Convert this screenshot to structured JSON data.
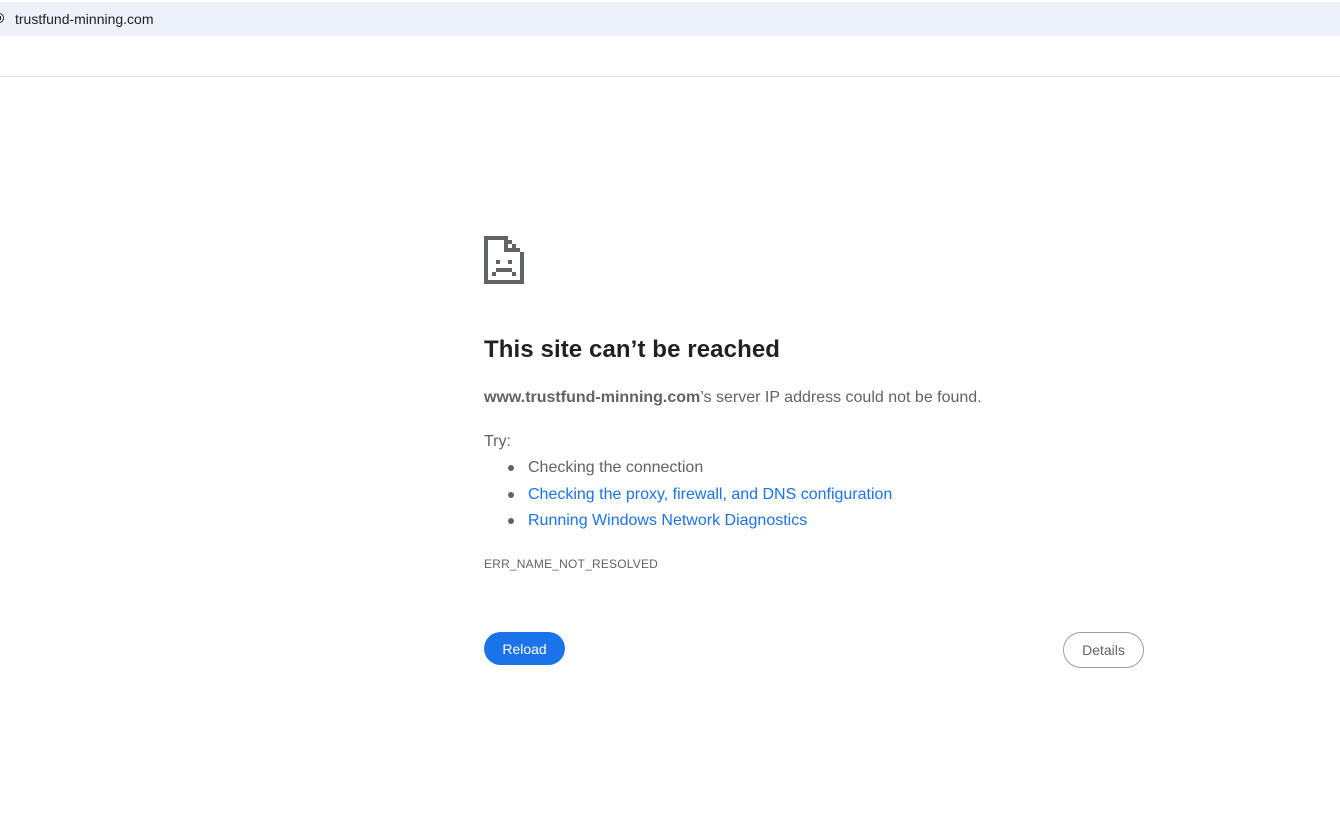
{
  "browser": {
    "address_bar": {
      "url": "trustfund-minning.com"
    }
  },
  "error_page": {
    "icon": "sad-document-icon",
    "title": "This site can’t be reached",
    "summary": {
      "host": "www.trustfund-minning.com",
      "message": "’s server IP address could not be found."
    },
    "try_label": "Try:",
    "suggestions": [
      {
        "text": "Checking the connection",
        "is_link": false
      },
      {
        "text": "Checking the proxy, firewall, and DNS configuration",
        "is_link": true
      },
      {
        "text": "Running Windows Network Diagnostics",
        "is_link": true
      }
    ],
    "error_code": "ERR_NAME_NOT_RESOLVED",
    "buttons": {
      "reload": "Reload",
      "details": "Details"
    }
  },
  "colors": {
    "accent": "#1a73e8",
    "text_primary": "#202124",
    "text_secondary": "#5f6368",
    "address_bar_bg": "#edf1fa"
  }
}
